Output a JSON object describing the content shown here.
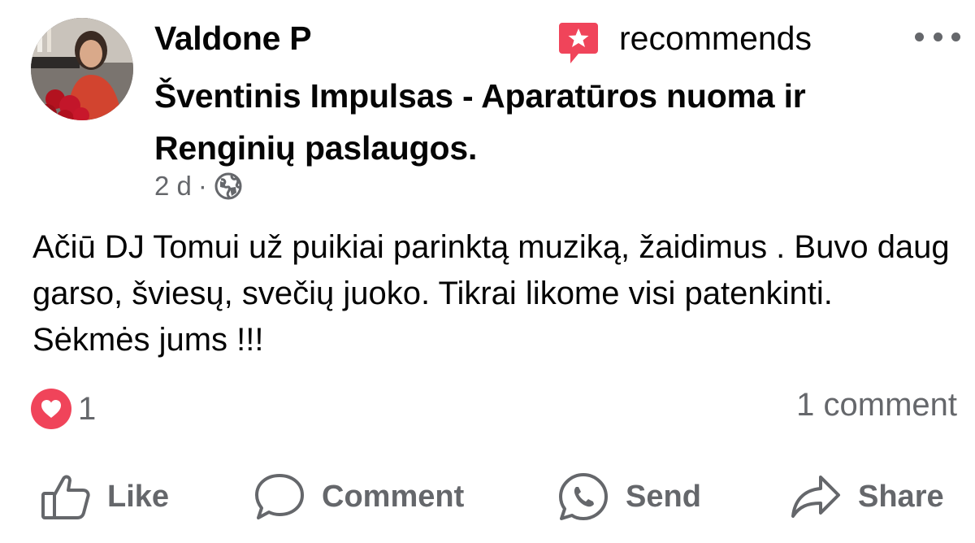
{
  "post": {
    "author": "Valdone P",
    "action": "recommends",
    "page_name": "Šventinis Impulsas - Aparatūros nuoma ir Renginių paslaugos.",
    "time": "2 d",
    "separator": "·",
    "privacy_icon": "globe-icon",
    "body": "Ačiū DJ Tomui už puikiai parinktą muziką, žaidimus . Buvo daug garso, šviesų, svečių juoko. Tikrai likome visi patenkinti. Sėkmės jums !!!"
  },
  "engagement": {
    "reaction_icon": "heart-icon",
    "reaction_count": "1",
    "comments": "1 comment"
  },
  "actions": {
    "like": "Like",
    "comment": "Comment",
    "send": "Send",
    "share": "Share"
  },
  "colors": {
    "recommend_icon": "#f0445a",
    "heart_badge": "#f0445a",
    "secondary_text": "#65676b",
    "primary_text": "#050505"
  }
}
